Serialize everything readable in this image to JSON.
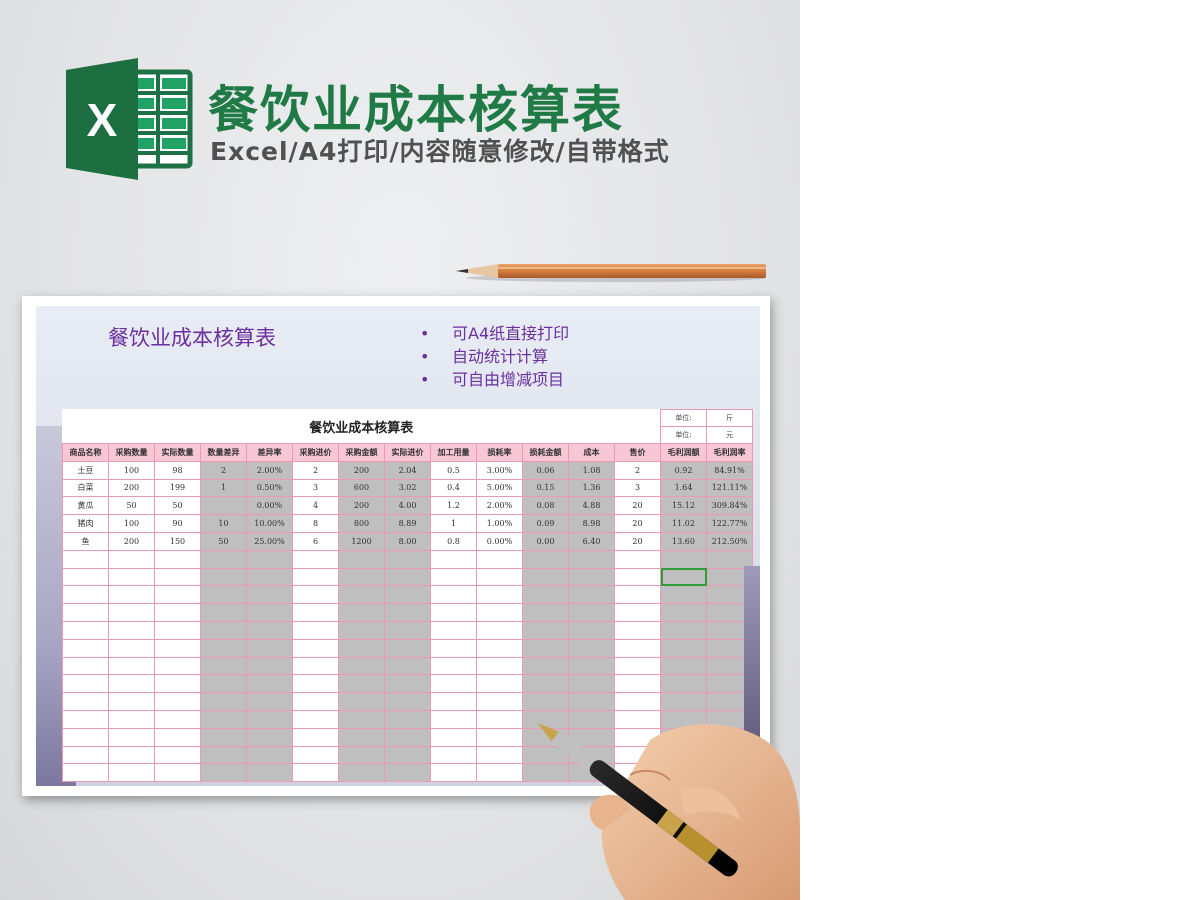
{
  "banner": {
    "title": "餐饮业成本核算表",
    "subtitle": "Excel/A4打印/内容随意修改/自带格式",
    "logo_letter": "X",
    "logo_icon": "excel-logo-icon",
    "title_color": "#1f7a45"
  },
  "sheet": {
    "title": "餐饮业成本核算表",
    "features": [
      "可A4纸直接打印",
      "自动统计计算",
      "可自由增减项目"
    ],
    "bullet": "•",
    "accent_color": "#6b2fa0"
  },
  "table": {
    "title": "餐饮业成本核算表",
    "unit_label_1": "单位:",
    "unit_value_1": "斤",
    "unit_label_2": "单位:",
    "unit_value_2": "元",
    "headers": [
      "商品名称",
      "采购数量",
      "实际数量",
      "数量差异",
      "差异率",
      "采购进价",
      "采购金额",
      "实际进价",
      "加工用量",
      "损耗率",
      "损耗金额",
      "成本",
      "售价",
      "毛利润额",
      "毛利润率"
    ],
    "rows": [
      [
        "土豆",
        "100",
        "98",
        "2",
        "2.00%",
        "2",
        "200",
        "2.04",
        "0.5",
        "3.00%",
        "0.06",
        "1.08",
        "2",
        "0.92",
        "84.91%"
      ],
      [
        "白菜",
        "200",
        "199",
        "1",
        "0.50%",
        "3",
        "600",
        "3.02",
        "0.4",
        "5.00%",
        "0.15",
        "1.36",
        "3",
        "1.64",
        "121.11%"
      ],
      [
        "黄瓜",
        "50",
        "50",
        "",
        "0.00%",
        "4",
        "200",
        "4.00",
        "1.2",
        "2.00%",
        "0.08",
        "4.88",
        "20",
        "15.12",
        "309.84%"
      ],
      [
        "猪肉",
        "100",
        "90",
        "10",
        "10.00%",
        "8",
        "800",
        "8.89",
        "1",
        "1.00%",
        "0.09",
        "8.98",
        "20",
        "11.02",
        "122.77%"
      ],
      [
        "鱼",
        "200",
        "150",
        "50",
        "25.00%",
        "6",
        "1200",
        "8.00",
        "0.8",
        "0.00%",
        "0.00",
        "6.40",
        "20",
        "13.60",
        "212.50%"
      ]
    ],
    "empty_rows": 13,
    "gray_columns": [
      3,
      4,
      6,
      7,
      10,
      11,
      13,
      14
    ],
    "grid_color": "#ef98b4",
    "header_fill": "#f7c7d6",
    "gray_fill": "#bfbfbf"
  },
  "decor": {
    "pencil_icon": "pencil-icon",
    "hand_icon": "hand-holding-pen-icon"
  }
}
